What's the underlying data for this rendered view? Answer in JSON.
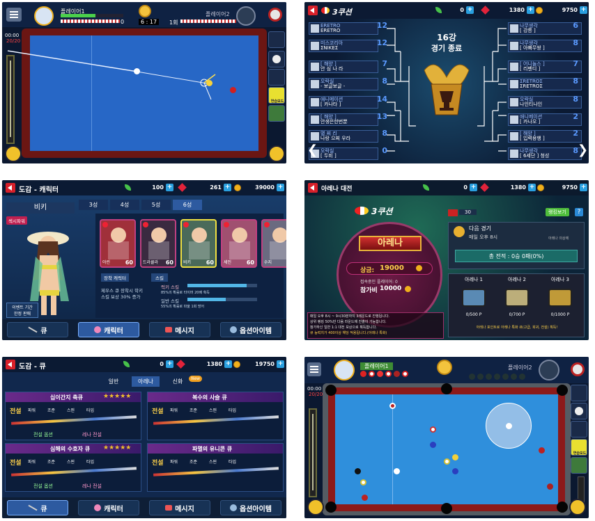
{
  "p1": {
    "player1": "플레이어1",
    "player2": "플레이어2",
    "score_left": "0",
    "timer": "6 : 17",
    "round": "1회",
    "score_right": "0",
    "clock": "00:00",
    "shots": "20/20",
    "side": {
      "label": "연습모드"
    }
  },
  "p2": {
    "title": "3쿠션",
    "leaf": "0",
    "gem": "1380",
    "coin": "9750",
    "center_title": "16강",
    "center_sub": "경기 종료",
    "left": [
      {
        "t1": "ERETRO",
        "t2": "ERETRO",
        "s": "12"
      },
      {
        "t1": "미스코리아",
        "t2": "ΣNIKEΣ",
        "s": "12"
      },
      {
        "t1": "[ 해양 ]",
        "t2": "안 심 나 라",
        "s": "7"
      },
      {
        "t1": "오락실",
        "t2": "- 보글보글 -",
        "s": "8"
      },
      {
        "t1": "애니메이션",
        "t2": "[ 카나타 ]",
        "s": "14"
      },
      {
        "t1": "[ 해양 ]",
        "t2": "안생은한번뿐",
        "s": "13"
      },
      {
        "t1": "멸 찌 리",
        "t2": "나랑 으찌 우라",
        "s": "8"
      },
      {
        "t1": "오락실",
        "t2": "[ 두비 ]",
        "s": "0"
      }
    ],
    "right": [
      {
        "t1": "나무생각",
        "t2": "[ 강릉 ]",
        "s": "6"
      },
      {
        "t1": "나무생각",
        "t2": "[ 아빠무쌍 ]",
        "s": "8"
      },
      {
        "t1": "[ 어니놀스 ]",
        "t2": "[ 리벤디 ]",
        "s": "7"
      },
      {
        "t1": "ΣRETROΣ",
        "t2": "ΣRETROΣ",
        "s": "8"
      },
      {
        "t1": "오락실",
        "t2": "나인티나인",
        "s": "8"
      },
      {
        "t1": "애니메이션",
        "t2": "[ 카나오 ]",
        "s": "2"
      },
      {
        "t1": "[ 해양 ]",
        "t2": "[ 입력용행 ]",
        "s": "2"
      },
      {
        "t1": "나무생각",
        "t2": "[ 6세단 ] 청성",
        "s": "8"
      }
    ]
  },
  "p3": {
    "title": "도감 - 캐릭터",
    "leaf": "100",
    "gem": "261",
    "coin": "39000",
    "char_name": "비키",
    "tabs": [
      "3성",
      "4성",
      "5성",
      "6성"
    ],
    "badge": "섹시파워",
    "event": "이벤트 기간\n한정 판매",
    "cards": [
      {
        "name": "아린",
        "lv": "60"
      },
      {
        "name": "드라큘라",
        "lv": "60"
      },
      {
        "name": "비키",
        "lv": "60"
      },
      {
        "name": "세인",
        "lv": "60"
      },
      {
        "name": "수지",
        "lv": "60"
      }
    ],
    "equip_title": "장착 캐릭터",
    "skill_title": "스킬",
    "desc": "제우스 큐 장착시 학키\n스킬 보상 30% 증가",
    "skill1_name": "럭키 스킬",
    "skill1_desc": "85%의 확률로 타이머 20배 획득",
    "skill2_name": "일반 스킬",
    "skill2_desc": "55%의 확률로 파울 1회 방어",
    "nav": [
      "큐",
      "캐릭터",
      "메시지",
      "옵션아이템"
    ]
  },
  "p4": {
    "title": "아레나 대전",
    "leaf": "0",
    "gem": "1380",
    "coin": "9750",
    "mode": "3쿠션",
    "ticket": "30",
    "ranking": "랭킹보기",
    "arena": "아레나",
    "prize_label": "상금:",
    "prize": "19000",
    "joined": "접속중인 플레이어: 0",
    "fee_label": "참가비",
    "fee": "10000",
    "next_game": "다음 경기",
    "next_time": "매일 오후 8시",
    "next_sub": "아레나 의상에",
    "record": "총 전적 : 0승 0패(0%)",
    "boxes": [
      {
        "name": "아레나 1",
        "pts": "0/500 P"
      },
      {
        "name": "아레나 2",
        "pts": "0/700 P"
      },
      {
        "name": "아레나 3",
        "pts": "0/1000 P"
      }
    ],
    "box_note": "아레나 포인트로 아레나 특화 큐(고급, 희귀, 전설) 획득!",
    "rules": [
      "매일 오후 8시 ~ 9시30분까지 3레운드로 진행됩니다.",
      "상위 랭킹 50%만 다음 라운드에 진출이 가능합니다.",
      "참가하신 일반 1:1 대전 보상으로 획득합니다.",
      "큐 능력치가 400이상 해당 적용됩니다.(아레나 특화)"
    ]
  },
  "p5": {
    "title": "도감 - 큐",
    "leaf": "0",
    "gem": "1380",
    "coin": "19750",
    "tabs": [
      "일반",
      "아레나",
      "신화"
    ],
    "new_badge": "New",
    "cues": [
      {
        "name": "십이간지 축큐",
        "grade": "전설",
        "opt": "전설 옵션",
        "opt2": "레나 전설"
      },
      {
        "name": "복수의 사슬 큐",
        "grade": "전설",
        "opt": "",
        "opt2": ""
      },
      {
        "name": "심해의 수호자 큐",
        "grade": "전설",
        "opt": "전설 옵션",
        "opt2": "레나 전설"
      },
      {
        "name": "파멸의 유니콘 큐",
        "grade": "전설",
        "opt": "",
        "opt2": ""
      }
    ],
    "stats": [
      "파워",
      "조준",
      "스핀",
      "타임"
    ],
    "nav": [
      "큐",
      "캐릭터",
      "메시지",
      "옵션아이템"
    ]
  },
  "p6": {
    "player1": "플레이어1",
    "player2": "플레이어2",
    "clock": "00:00",
    "shots": "20/20",
    "side": {
      "label": "연습모드"
    }
  }
}
